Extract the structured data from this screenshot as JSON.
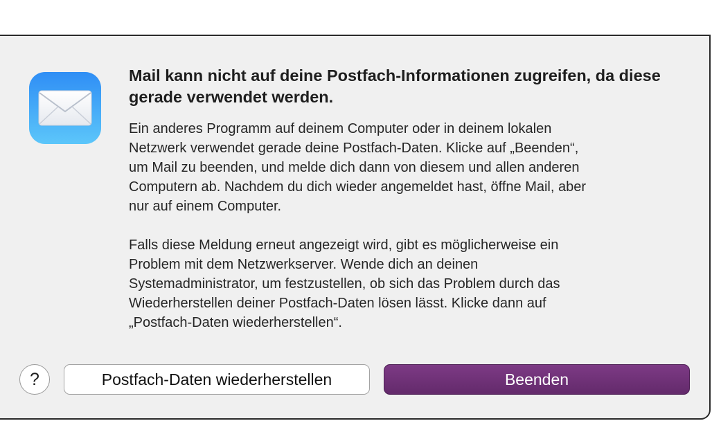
{
  "dialog": {
    "title": "Mail kann nicht auf deine Postfach-Informationen zugreifen, da diese gerade verwendet werden.",
    "paragraph1": "Ein anderes Programm auf deinem Computer oder in deinem lokalen\nNetzwerk verwendet gerade deine Postfach-Daten. Klicke auf „Beenden“,\num Mail zu beenden, und melde dich dann von diesem und allen anderen\nComputern ab. Nachdem du dich wieder angemeldet hast, öffne Mail, aber\nnur auf einem Computer.",
    "paragraph2": "Falls diese Meldung erneut angezeigt wird, gibt es möglicherweise ein\nProblem mit dem Netzwerkserver. Wende dich an deinen\nSystemadministrator, um festzustellen, ob sich das Problem durch das\nWiederherstellen deiner Postfach-Daten lösen lässt. Klicke dann auf\n„Postfach-Daten wiederherstellen“.",
    "app_icon": "mail-envelope-icon"
  },
  "buttons": {
    "help_label": "?",
    "restore_label": "Postfach-Daten wiederherstellen",
    "quit_label": "Beenden"
  },
  "colors": {
    "accent": "#6e3176",
    "dialog_background": "#f0f0f0",
    "icon_gradient_top": "#2f8ef5",
    "icon_gradient_bottom": "#5cc6fa"
  }
}
